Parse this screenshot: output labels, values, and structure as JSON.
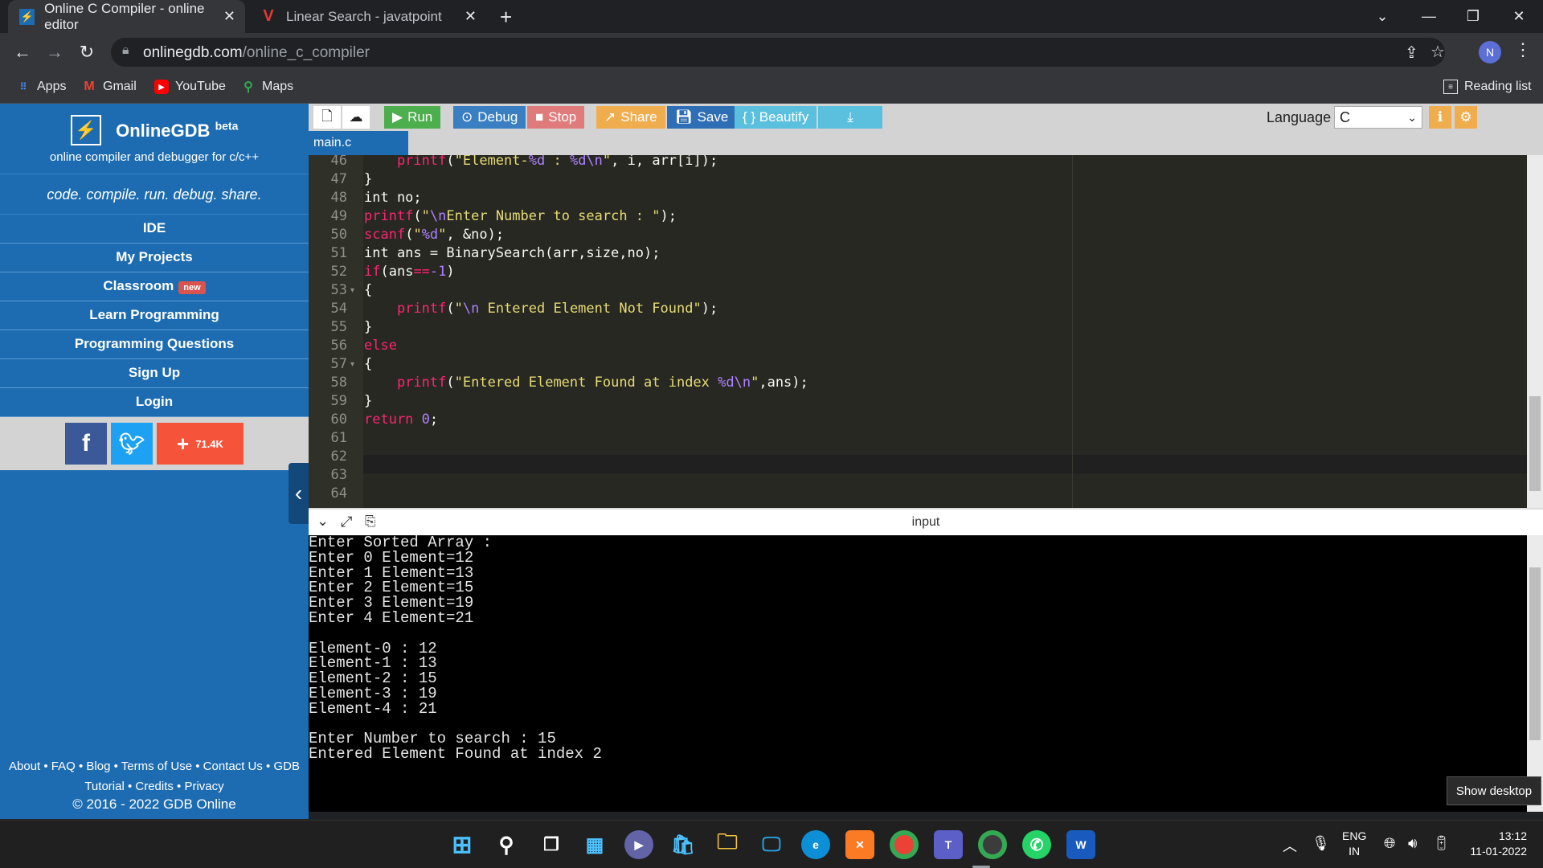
{
  "browser": {
    "tabs": [
      {
        "title": "Online C Compiler - online editor",
        "active": true
      },
      {
        "title": "Linear Search - javatpoint",
        "active": false
      }
    ],
    "url_domain": "onlinegdb.com",
    "url_path": "/online_c_compiler",
    "profile_initial": "N",
    "bookmarks": [
      "Apps",
      "Gmail",
      "YouTube",
      "Maps"
    ],
    "reading_list": "Reading list"
  },
  "sidebar": {
    "brand": "OnlineGDB",
    "beta": "beta",
    "subtitle": "online compiler and debugger for c/c++",
    "tagline": "code. compile. run. debug. share.",
    "menu": [
      "IDE",
      "My Projects",
      "Classroom",
      "Learn Programming",
      "Programming Questions",
      "Sign Up",
      "Login"
    ],
    "classroom_badge": "new",
    "share_count": "71.4K",
    "footer_line1": "About • FAQ • Blog • Terms of Use • Contact Us • GDB",
    "footer_line2": "Tutorial • Credits • Privacy",
    "copyright": "© 2016 - 2022 GDB Online"
  },
  "ide_toolbar": {
    "run": "Run",
    "debug": "Debug",
    "stop": "Stop",
    "share": "Share",
    "save": "Save",
    "beautify": "{ } Beautify",
    "language_label": "Language",
    "language_value": "C"
  },
  "file_tab": "main.c",
  "editor": {
    "line_numbers": [
      "46",
      "47",
      "48",
      "49",
      "50",
      "51",
      "52",
      "53",
      "54",
      "55",
      "56",
      "57",
      "58",
      "59",
      "60",
      "61",
      "62",
      "63",
      "64"
    ],
    "fold_markers": [
      "53",
      "57"
    ]
  },
  "console": {
    "title": "input",
    "lines": [
      "Enter Sorted Array :",
      "Enter 0 Element=12",
      "Enter 1 Element=13",
      "Enter 2 Element=15",
      "Enter 3 Element=19",
      "Enter 4 Element=21",
      "",
      "Element-0 : 12",
      "Element-1 : 13",
      "Element-2 : 15",
      "Element-3 : 19",
      "Element-4 : 21",
      "",
      "Enter Number to search : 15",
      "Entered Element Found at index 2"
    ]
  },
  "tooltip": "Show desktop",
  "taskbar": {
    "lang_top": "ENG",
    "lang_bottom": "IN",
    "time": "13:12",
    "date": "11-01-2022"
  }
}
